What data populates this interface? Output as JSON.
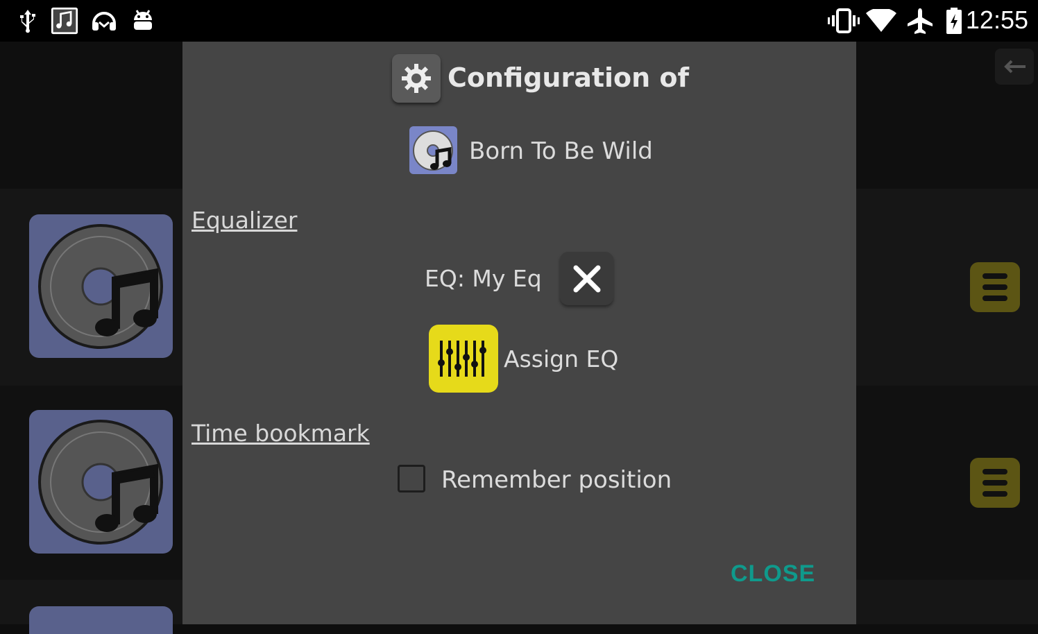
{
  "status_bar": {
    "time": "12:55",
    "left_icons": [
      "usb-icon",
      "music-notification-icon",
      "headset-icon",
      "android-debug-icon"
    ],
    "right_icons": [
      "vibrate-icon",
      "wifi-icon",
      "airplane-mode-icon",
      "battery-charging-icon"
    ]
  },
  "dialog": {
    "title": "Configuration of",
    "song_title": "Born To Be Wild",
    "equalizer_section": "Equalizer",
    "eq_label": "EQ: My Eq",
    "assign_eq_label": "Assign EQ",
    "time_bookmark_section": "Time bookmark",
    "remember_position_label": "Remember position",
    "remember_position_checked": false,
    "close_label": "CLOSE"
  },
  "colors": {
    "dialog_bg": "#454545",
    "accent_teal": "#0f9a8c",
    "eq_button_yellow": "#e6da1a",
    "album_bg": "#59618c"
  }
}
